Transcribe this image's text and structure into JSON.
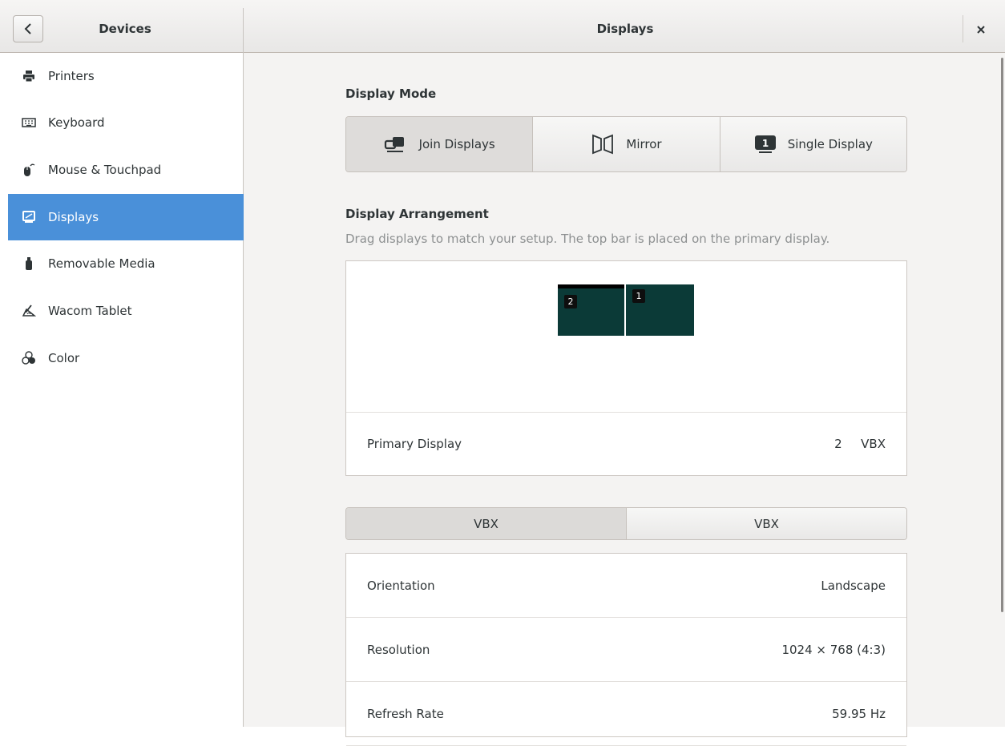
{
  "header": {
    "back_icon": "chevron-left-icon",
    "left_title": "Devices",
    "title": "Displays",
    "close_icon": "close-icon"
  },
  "sidebar": {
    "items": [
      {
        "label": "Printers",
        "icon": "printer-icon",
        "active": false
      },
      {
        "label": "Keyboard",
        "icon": "keyboard-icon",
        "active": false
      },
      {
        "label": "Mouse & Touchpad",
        "icon": "mouse-icon",
        "active": false
      },
      {
        "label": "Displays",
        "icon": "display-icon",
        "active": true
      },
      {
        "label": "Removable Media",
        "icon": "usb-media-icon",
        "active": false
      },
      {
        "label": "Wacom Tablet",
        "icon": "tablet-icon",
        "active": false
      },
      {
        "label": "Color",
        "icon": "color-icon",
        "active": false
      }
    ],
    "active_color": "#4a90d9"
  },
  "display_mode": {
    "title": "Display Mode",
    "options": [
      {
        "label": "Join Displays",
        "icon": "join-displays-icon",
        "selected": true
      },
      {
        "label": "Mirror",
        "icon": "mirror-icon",
        "selected": false
      },
      {
        "label": "Single Display",
        "icon": "single-display-icon",
        "selected": false
      }
    ]
  },
  "arrangement": {
    "title": "Display Arrangement",
    "hint": "Drag displays to match your setup. The top bar is placed on the primary display.",
    "monitors": [
      {
        "number": "2",
        "primary": true
      },
      {
        "number": "1",
        "primary": false
      }
    ],
    "primary_label": "Primary Display",
    "primary_number": "2",
    "primary_name": "VBX"
  },
  "monitor_tabs": [
    {
      "label": "VBX",
      "active": true
    },
    {
      "label": "VBX",
      "active": false
    }
  ],
  "settings": {
    "rows": [
      {
        "label": "Orientation",
        "value": "Landscape"
      },
      {
        "label": "Resolution",
        "value": "1024 × 768 (4:3)"
      },
      {
        "label": "Refresh Rate",
        "value": "59.95 Hz"
      }
    ]
  }
}
